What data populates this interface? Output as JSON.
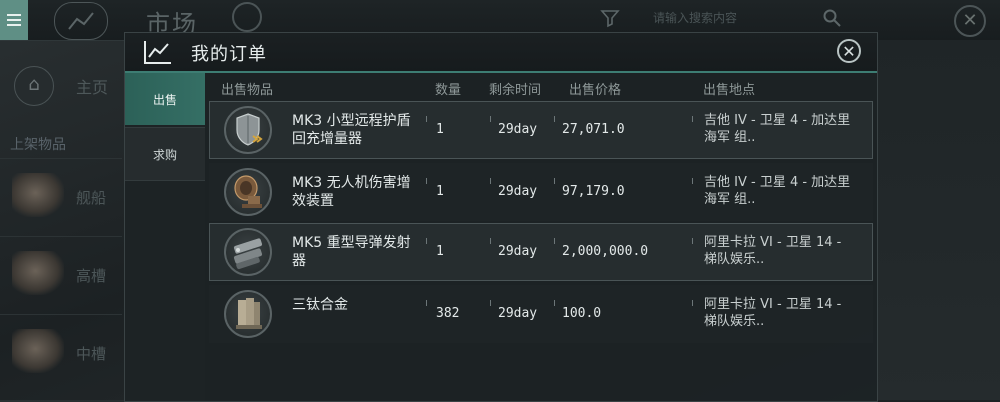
{
  "background": {
    "title": "市场",
    "search_placeholder": "请输入搜索内容",
    "home_label": "主页",
    "shelf_label": "上架物品",
    "categories": [
      "舰船",
      "高槽",
      "中槽"
    ]
  },
  "modal": {
    "title": "我的订单",
    "tabs": [
      {
        "label": "出售",
        "active": true
      },
      {
        "label": "求购",
        "active": false
      }
    ],
    "columns": {
      "item": "出售物品",
      "quantity": "数量",
      "remaining": "剩余时间",
      "price": "出售价格",
      "location": "出售地点"
    },
    "orders": [
      {
        "name": "MK3 小型远程护盾回充增量器",
        "quantity": "1",
        "remaining": "29day",
        "price": "27,071.0",
        "location": "吉他 IV - 卫星 4 - 加达里海军 组..",
        "icon": "shield-booster-icon"
      },
      {
        "name": "MK3 无人机伤害增效装置",
        "quantity": "1",
        "remaining": "29day",
        "price": "97,179.0",
        "location": "吉他 IV - 卫星 4 - 加达里海军 组..",
        "icon": "drone-damage-amplifier-icon"
      },
      {
        "name": "MK5 重型导弹发射器",
        "quantity": "1",
        "remaining": "29day",
        "price": "2,000,000.0",
        "location": "阿里卡拉 VI - 卫星 14 - 梯队娱乐..",
        "icon": "missile-launcher-icon"
      },
      {
        "name": "三钛合金",
        "quantity": "382",
        "remaining": "29day",
        "price": "100.0",
        "location": "阿里卡拉 VI - 卫星 14 - 梯队娱乐..",
        "icon": "tritanium-icon"
      }
    ]
  },
  "colors": {
    "accent": "#3d7d73",
    "active_tab": "#356f65",
    "menu": "#5f8f85"
  }
}
